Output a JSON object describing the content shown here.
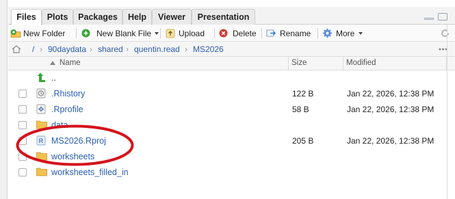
{
  "tabs": [
    {
      "label": "Files",
      "active": true
    },
    {
      "label": "Plots",
      "active": false
    },
    {
      "label": "Packages",
      "active": false
    },
    {
      "label": "Help",
      "active": false
    },
    {
      "label": "Viewer",
      "active": false
    },
    {
      "label": "Presentation",
      "active": false
    }
  ],
  "toolbar": {
    "new_folder": "New Folder",
    "new_blank_file": "New Blank File",
    "upload": "Upload",
    "delete": "Delete",
    "rename": "Rename",
    "more": "More"
  },
  "breadcrumb": {
    "root": "/",
    "parts": [
      "90daydata",
      "shared",
      "quentin.read",
      "MS2026"
    ]
  },
  "columns": {
    "name": "Name",
    "size": "Size",
    "modified": "Modified"
  },
  "parent_dir": "..",
  "files": [
    {
      "name": ".Rhistory",
      "size": "122 B",
      "modified": "Jan 22, 2026, 12:38 PM",
      "icon": "rhistory-icon"
    },
    {
      "name": ".Rprofile",
      "size": "58 B",
      "modified": "Jan 22, 2026, 12:38 PM",
      "icon": "rprofile-gear-icon"
    },
    {
      "name": "data",
      "size": "",
      "modified": "",
      "icon": "folder-icon"
    },
    {
      "name": "MS2026.Rproj",
      "size": "205 B",
      "modified": "Jan 22, 2026, 12:38 PM",
      "icon": "rproj-icon"
    },
    {
      "name": "worksheets",
      "size": "",
      "modified": "",
      "icon": "folder-icon"
    },
    {
      "name": "worksheets_filled_in",
      "size": "",
      "modified": "",
      "icon": "folder-icon"
    }
  ],
  "colors": {
    "link": "#2a5db0",
    "highlight_oval": "#d4141c",
    "folder": "#f2c14e"
  }
}
